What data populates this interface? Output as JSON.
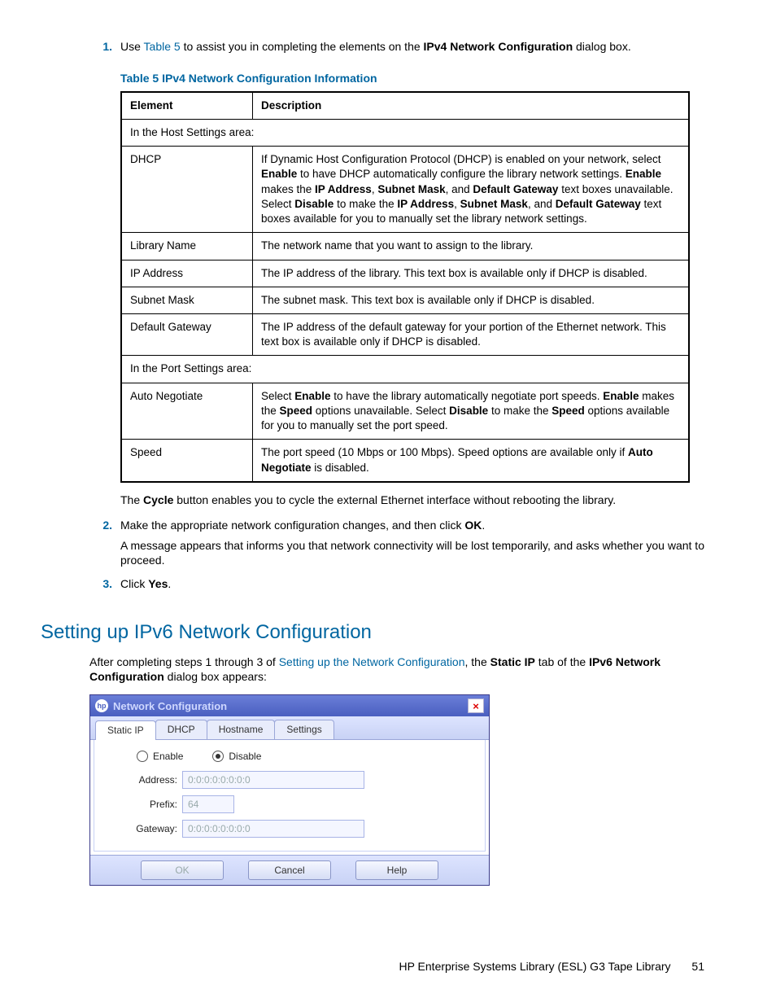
{
  "steps": {
    "s1": {
      "num": "1.",
      "pre": "Use ",
      "link": "Table 5",
      "post": " to assist you in completing the elements on the ",
      "bold": "IPv4 Network Configuration",
      "tail": " dialog box."
    },
    "s2": {
      "num": "2.",
      "line1_pre": "Make the appropriate network configuration changes, and then click ",
      "line1_bold": "OK",
      "line1_post": ".",
      "line2": "A message appears that informs you that network connectivity will be lost temporarily, and asks whether you want to proceed."
    },
    "s3": {
      "num": "3.",
      "pre": "Click ",
      "bold": "Yes",
      "post": "."
    }
  },
  "table_caption": "Table 5 IPv4 Network Configuration Information",
  "table": {
    "h1": "Element",
    "h2": "Description",
    "r_host_header": "In the Host Settings area:",
    "r_dhcp_e": "DHCP",
    "r_dhcp_d_a": "If Dynamic Host Configuration Protocol (DHCP) is enabled on your network, select ",
    "r_dhcp_d_b": "Enable",
    "r_dhcp_d_c": " to have DHCP automatically configure the library network settings. ",
    "r_dhcp_d_d": "Enable",
    "r_dhcp_d_e": " makes the ",
    "r_dhcp_d_f": "IP Address",
    "r_dhcp_d_g": ", ",
    "r_dhcp_d_h": "Subnet Mask",
    "r_dhcp_d_i": ", and ",
    "r_dhcp_d_j": "Default Gateway",
    "r_dhcp_d_k": " text boxes unavailable. Select ",
    "r_dhcp_d_l": "Disable",
    "r_dhcp_d_m": " to make the ",
    "r_dhcp_d_n": "IP Address",
    "r_dhcp_d_o": ", ",
    "r_dhcp_d_p": "Subnet Mask",
    "r_dhcp_d_q": ", and ",
    "r_dhcp_d_r": "Default Gateway",
    "r_dhcp_d_s": " text boxes available for you to manually set the library network settings.",
    "r_lib_e": "Library Name",
    "r_lib_d": "The network name that you want to assign to the library.",
    "r_ip_e": "IP Address",
    "r_ip_d": "The IP address of the library. This text box is available only if DHCP is disabled.",
    "r_sm_e": "Subnet Mask",
    "r_sm_d": "The subnet mask. This text box is available only if DHCP is disabled.",
    "r_dg_e": "Default Gateway",
    "r_dg_d": "The IP address of the default gateway for your portion of the Ethernet network. This text box is available only if DHCP is disabled.",
    "r_port_header": "In the Port Settings area:",
    "r_an_e": "Auto Negotiate",
    "r_an_d_a": "Select ",
    "r_an_d_b": "Enable",
    "r_an_d_c": " to have the library automatically negotiate port speeds. ",
    "r_an_d_d": "Enable",
    "r_an_d_e": " makes the ",
    "r_an_d_f": "Speed",
    "r_an_d_g": " options unavailable. Select ",
    "r_an_d_h": "Disable",
    "r_an_d_i": " to make the ",
    "r_an_d_j": "Speed",
    "r_an_d_k": " options available for you to manually set the port speed.",
    "r_sp_e": "Speed",
    "r_sp_d_a": "The port speed (10 Mbps or 100 Mbps). Speed options are available only if ",
    "r_sp_d_b": "Auto Negotiate",
    "r_sp_d_c": " is disabled."
  },
  "after_table": {
    "pre": "The ",
    "bold": "Cycle",
    "post": " button enables you to cycle the external Ethernet interface without rebooting the library."
  },
  "section_heading": "Setting up IPv6 Network Configuration",
  "section_para": {
    "a": "After completing steps 1 through 3 of ",
    "link": "Setting up the Network Configuration",
    "b": ", the ",
    "bold1": "Static IP",
    "c": " tab of the ",
    "bold2": "IPv6 Network Configuration",
    "d": " dialog box appears:"
  },
  "dialog": {
    "title": "Network Configuration",
    "tabs": {
      "t1": "Static IP",
      "t2": "DHCP",
      "t3": "Hostname",
      "t4": "Settings"
    },
    "radio_enable": "Enable",
    "radio_disable": "Disable",
    "addr_lbl": "Address:",
    "addr_val": "0:0:0:0:0:0:0:0",
    "prefix_lbl": "Prefix:",
    "prefix_val": "64",
    "gw_lbl": "Gateway:",
    "gw_val": "0:0:0:0:0:0:0:0",
    "btn_ok": "OK",
    "btn_cancel": "Cancel",
    "btn_help": "Help"
  },
  "footer": {
    "text": "HP Enterprise Systems Library (ESL) G3 Tape Library",
    "page": "51"
  }
}
